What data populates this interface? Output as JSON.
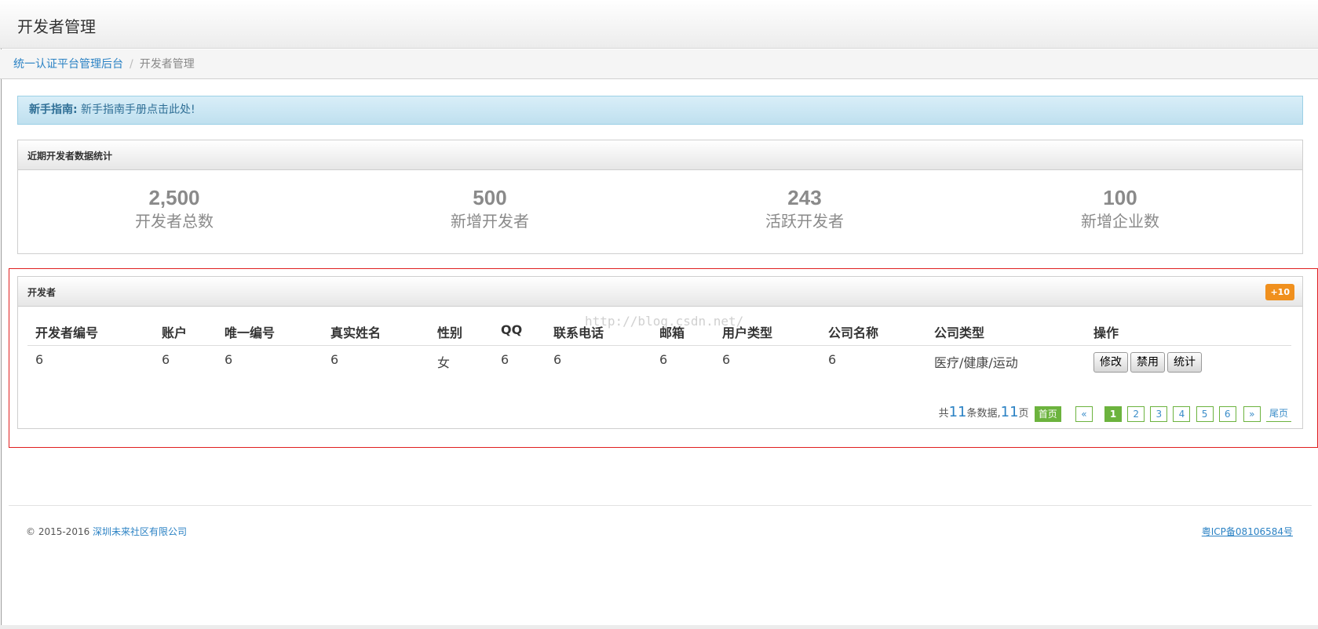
{
  "header": {
    "title": "开发者管理"
  },
  "breadcrumb": {
    "root": "统一认证平台管理后台",
    "separator": "/",
    "current": "开发者管理"
  },
  "alert": {
    "label": "新手指南:",
    "text": " 新手指南手册点击此处!"
  },
  "stats": {
    "title": "近期开发者数据统计",
    "items": [
      {
        "value": "2,500",
        "label": "开发者总数"
      },
      {
        "value": "500",
        "label": "新增开发者"
      },
      {
        "value": "243",
        "label": "活跃开发者"
      },
      {
        "value": "100",
        "label": "新增企业数"
      }
    ]
  },
  "developers": {
    "title": "开发者",
    "badge": "+10",
    "columns": [
      "开发者编号",
      "账户",
      "唯一编号",
      "真实姓名",
      "性别",
      "QQ",
      "联系电话",
      "邮箱",
      "用户类型",
      "公司名称",
      "公司类型",
      "操作"
    ],
    "rows": [
      [
        "6",
        "6",
        "6",
        "6",
        "女",
        "6",
        "6",
        "6",
        "6",
        "6",
        "医疗/健康/运动"
      ]
    ],
    "actions": [
      "修改",
      "禁用",
      "统计"
    ]
  },
  "pager": {
    "prefix": "共",
    "total": "11",
    "middle": "条数据,",
    "pages": "11",
    "suffix": "页",
    "first": "首页",
    "prev": "«",
    "page_numbers": [
      "1",
      "2",
      "3",
      "4",
      "5",
      "6"
    ],
    "active_page": "1",
    "next": "»",
    "last": "尾页"
  },
  "watermark": "http://blog.csdn.net/",
  "footer": {
    "copyright": "© 2015-2016 ",
    "company": "深圳未来社区有限公司",
    "icp": "粤ICP备08106584号"
  },
  "colors": {
    "link": "#2b82c4",
    "badge": "#f0901e",
    "pager_green": "#6cb33e",
    "highlight_frame": "#e02020",
    "alert_bg": "#cbe7f3"
  }
}
